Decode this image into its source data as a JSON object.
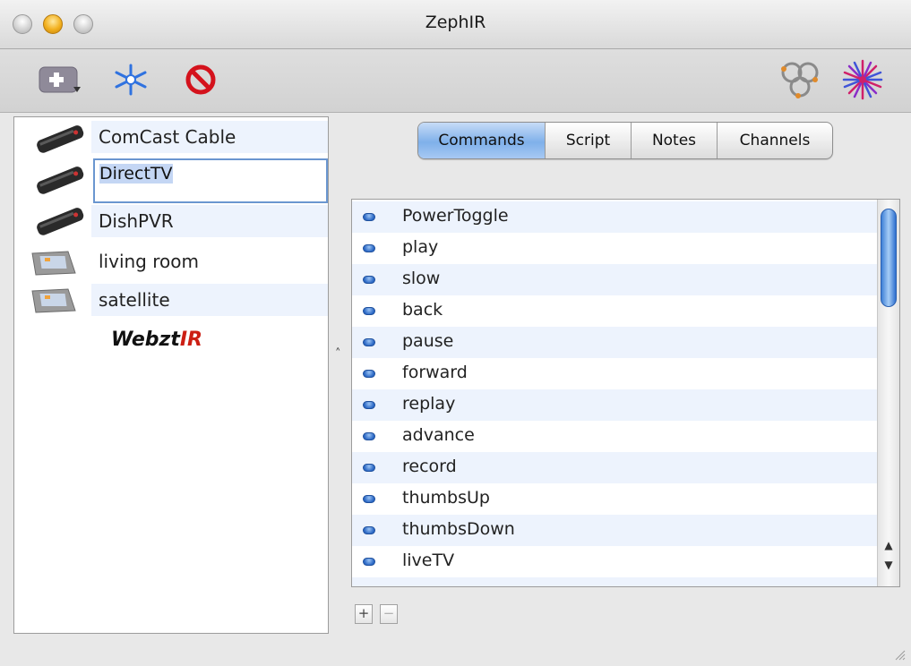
{
  "window": {
    "title": "ZephIR"
  },
  "devices": [
    {
      "label": "ComCast Cable",
      "icon": "remote-control-icon"
    },
    {
      "label": "DirectTV",
      "icon": "remote-control-icon",
      "editing": true
    },
    {
      "label": "DishPVR",
      "icon": "remote-control-icon"
    },
    {
      "label": "living room",
      "icon": "touchscreen-device-icon"
    },
    {
      "label": "satellite",
      "icon": "touchscreen-device-icon"
    }
  ],
  "brand": {
    "prefix": "Webzt",
    "suffix": "IR"
  },
  "tabs": [
    {
      "label": "Commands",
      "selected": true
    },
    {
      "label": "Script"
    },
    {
      "label": "Notes"
    },
    {
      "label": "Channels"
    }
  ],
  "commands": [
    "PowerToggle",
    "play",
    "slow",
    "back",
    "pause",
    "forward",
    "replay",
    "advance",
    "record",
    "thumbsUp",
    "thumbsDown",
    "liveTV"
  ],
  "buttons": {
    "add": "+",
    "remove": "−"
  },
  "colors": {
    "selection": "#7fb0ea",
    "alt_row": "#edf3fd",
    "brand_red": "#cc1f14",
    "stop": "#d4121c"
  }
}
